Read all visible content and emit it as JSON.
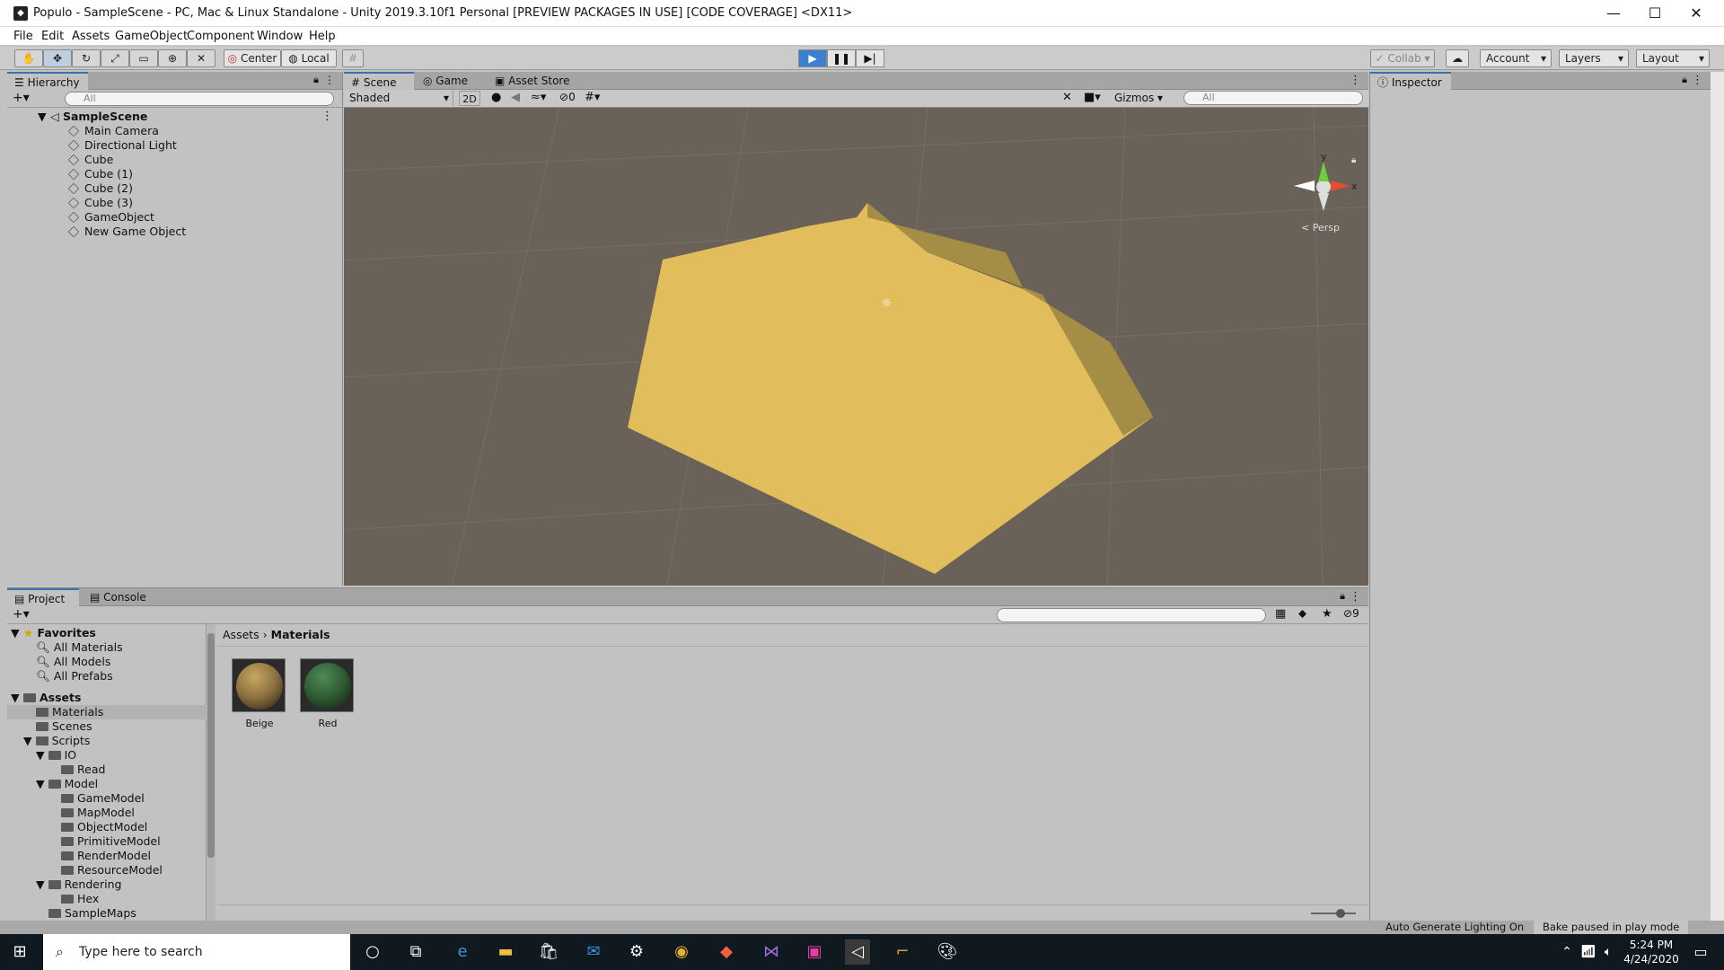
{
  "window": {
    "title": "Populo - SampleScene - PC, Mac & Linux Standalone - Unity 2019.3.10f1 Personal [PREVIEW PACKAGES IN USE] [CODE COVERAGE] <DX11>",
    "controls": {
      "minimize": "—",
      "maximize": "☐",
      "close": "✕"
    }
  },
  "menu": [
    "File",
    "Edit",
    "Assets",
    "GameObject",
    "Component",
    "Window",
    "Help"
  ],
  "toolbar": {
    "pivot": "Center",
    "space": "Local",
    "collab": "Collab",
    "account": "Account",
    "layers": "Layers",
    "layout": "Layout"
  },
  "hierarchy": {
    "tab": "Hierarchy",
    "search_placeholder": "All",
    "scene": "SampleScene",
    "items": [
      "Main Camera",
      "Directional Light",
      "Cube",
      "Cube (1)",
      "Cube (2)",
      "Cube (3)",
      "GameObject",
      "New Game Object"
    ]
  },
  "scene_view": {
    "tabs": [
      "Scene",
      "Game",
      "Asset Store"
    ],
    "shading": "Shaded",
    "mode_2d": "2D",
    "hidden_count": "0",
    "gizmos": "Gizmos",
    "search_placeholder": "All",
    "persp_label": "< Persp",
    "axis_y": "y",
    "axis_x": "x",
    "ground_color": "#6a6158",
    "shape_color": "#e1bd5b",
    "shape_side_color": "#a48d45"
  },
  "inspector": {
    "tab": "Inspector"
  },
  "project": {
    "tabs": [
      "Project",
      "Console"
    ],
    "hidden_count": "9",
    "favorites": {
      "label": "Favorites",
      "items": [
        "All Materials",
        "All Models",
        "All Prefabs"
      ]
    },
    "assets_label": "Assets",
    "tree": {
      "materials": "Materials",
      "scenes": "Scenes",
      "scripts": "Scripts",
      "io": "IO",
      "read": "Read",
      "model": "Model",
      "model_items": [
        "GameModel",
        "MapModel",
        "ObjectModel",
        "PrimitiveModel",
        "RenderModel",
        "ResourceModel"
      ],
      "rendering": "Rendering",
      "hex": "Hex",
      "samplemaps": "SampleMaps"
    },
    "breadcrumb": {
      "root": "Assets",
      "current": "Materials"
    },
    "materials": [
      {
        "name": "Beige",
        "color": "#8a7040"
      },
      {
        "name": "Red",
        "color": "#2f5a33"
      }
    ]
  },
  "status": {
    "lighting": "Auto Generate Lighting On",
    "bake": "Bake paused in play mode"
  },
  "taskbar": {
    "search_placeholder": "Type here to search",
    "time": "5:24 PM",
    "date": "4/24/2020"
  }
}
